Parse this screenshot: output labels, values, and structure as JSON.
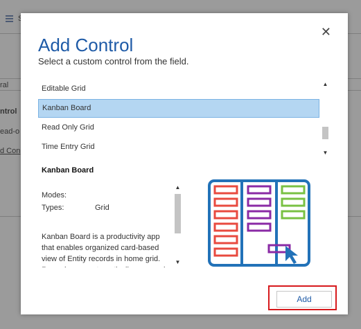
{
  "background": {
    "toolbar_text": "S",
    "items": [
      "ral",
      "ntrol",
      "ead-o",
      "d Con"
    ]
  },
  "dialog": {
    "title": "Add Control",
    "subtitle": "Select a custom control from the field.",
    "close_label": "✕",
    "controls": [
      {
        "label": "Editable Grid",
        "selected": false
      },
      {
        "label": "Kanban Board",
        "selected": true
      },
      {
        "label": "Read Only Grid",
        "selected": false
      },
      {
        "label": "Time Entry Grid",
        "selected": false
      }
    ],
    "details": {
      "title": "Kanban Board",
      "modes_label": "Modes:",
      "modes_value": "",
      "types_label": "Types:",
      "types_value": "Grid",
      "description": "Kanban Board is a productivity app that enables organized card-based view of Entity records in home grid. Records are systematically arranged"
    },
    "preview_icon": "kanban-board-icon",
    "add_label": "Add"
  },
  "colors": {
    "accent": "#1f5ba7",
    "highlight": "#d7191c",
    "selected_bg": "#b4d6f2",
    "card_red": "#e84a3f",
    "card_purple": "#8a2aa5",
    "card_green": "#79c143",
    "board_blue": "#2272b8"
  }
}
